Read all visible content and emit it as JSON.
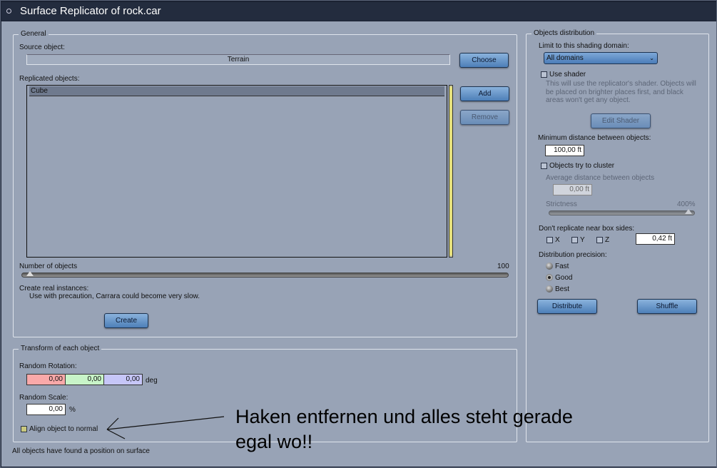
{
  "window": {
    "title": "Surface Replicator of rock.car"
  },
  "general": {
    "legend": "General",
    "source_label": "Source object:",
    "source_value": "Terrain",
    "choose": "Choose",
    "replicated_label": "Replicated objects:",
    "replicated_items": [
      "Cube"
    ],
    "add": "Add",
    "remove": "Remove",
    "number_label": "Number of objects",
    "number_value": "100",
    "create_label": "Create real instances:",
    "create_hint": "Use with precaution, Carrara could become very slow.",
    "create": "Create"
  },
  "transform": {
    "legend": "Transform of each object",
    "rotation_label": "Random Rotation:",
    "rotation": [
      "0,00",
      "0,00",
      "0,00"
    ],
    "rotation_unit": "deg",
    "scale_label": "Random Scale:",
    "scale": "0,00",
    "scale_unit": "%",
    "align_label": "Align object to normal",
    "align_checked": false
  },
  "status": "All objects have found a position on surface",
  "distribution": {
    "legend": "Objects distribution",
    "domain_label": "Limit to this shading domain:",
    "domain_value": "All domains",
    "use_shader": "Use shader",
    "shader_hint": [
      "This will use the replicator's shader. Objects will",
      "be placed on brighter places first, and black",
      "areas won't get any object."
    ],
    "edit_shader": "Edit Shader",
    "min_dist_label": "Minimum distance between objects:",
    "min_dist": "100,00 ft",
    "cluster": "Objects try to cluster",
    "avg_label": "Average distance between objects",
    "avg": "0,00 ft",
    "strictness_label": "Strictness",
    "strictness_value": "400%",
    "strictness_fraction": 1.0,
    "box_label": "Don't replicate near box sides:",
    "axes": [
      "X",
      "Y",
      "Z"
    ],
    "box_dist": "0,42 ft",
    "precision_label": "Distribution precision:",
    "precision_options": [
      "Fast",
      "Good",
      "Best"
    ],
    "precision_selected": "Good",
    "distribute": "Distribute",
    "shuffle": "Shuffle"
  },
  "annotation": {
    "line1": "Haken entfernen und alles steht gerade",
    "line2": "egal wo!!"
  }
}
